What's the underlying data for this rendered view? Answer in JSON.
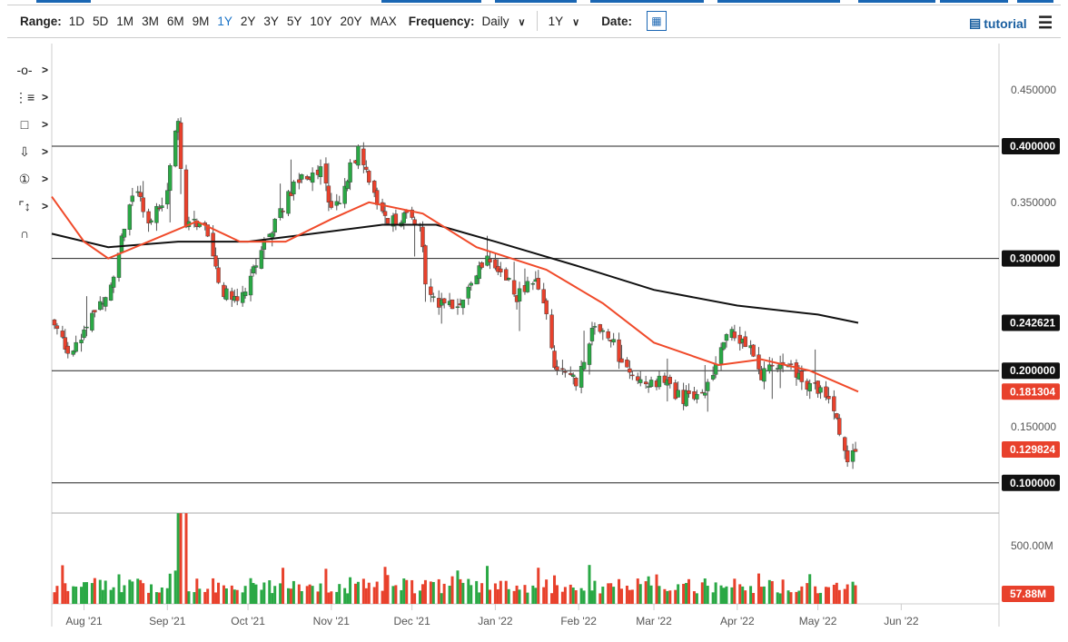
{
  "toolbar": {
    "range_label": "Range:",
    "ranges": [
      "1D",
      "5D",
      "1M",
      "3M",
      "6M",
      "9M",
      "1Y",
      "2Y",
      "3Y",
      "5Y",
      "10Y",
      "20Y",
      "MAX"
    ],
    "active_range": "1Y",
    "frequency_label": "Frequency:",
    "frequency": "Daily",
    "period": "1Y",
    "date_label": "Date:",
    "tutorial": "tutorial"
  },
  "tools": [
    "crosshair-tool",
    "trendline-tool",
    "rectangle-tool",
    "arrow-tool",
    "annotation-tool",
    "fibonacci-tool",
    "magnet-tool"
  ],
  "colors": {
    "up": "#2aa845",
    "down": "#e8412c",
    "ma_fast": "#f04a2a",
    "ma_slow": "#111111"
  },
  "chart_data": {
    "type": "candlestick",
    "x_ticks": [
      [
        "Aug '21",
        "2021-08-01"
      ],
      [
        "Sep '21",
        "2021-09-01"
      ],
      [
        "Oct '21",
        "2021-10-01"
      ],
      [
        "Nov '21",
        "2021-11-01"
      ],
      [
        "Dec '21",
        "2021-12-01"
      ],
      [
        "Jan '22",
        "2022-01-01"
      ],
      [
        "Feb '22",
        "2022-02-01"
      ],
      [
        "Mar '22",
        "2022-03-01"
      ],
      [
        "Apr '22",
        "2022-04-01"
      ],
      [
        "May '22",
        "2022-05-01"
      ],
      [
        "Jun '22",
        "2022-06-01"
      ]
    ],
    "y_ticks": [
      "0.450000",
      "0.350000",
      "0.150000"
    ],
    "y_labels_boxed": [
      {
        "v": 0.4,
        "t": "0.400000"
      },
      {
        "v": 0.3,
        "t": "0.300000"
      },
      {
        "v": 0.2,
        "t": "0.200000"
      },
      {
        "v": 0.1,
        "t": "0.100000"
      }
    ],
    "horizontal_lines": [
      0.4,
      0.3,
      0.2,
      0.1
    ],
    "ylim": [
      0.075,
      0.48
    ],
    "ma_slow_label": "0.242621",
    "ma_fast_label": "0.181304",
    "last_price_label": "0.129824",
    "volume_tick": "500.00M",
    "last_volume_label": "57.88M",
    "price_path": [
      [
        "2021-07-20",
        0.245
      ],
      [
        "2021-07-27",
        0.215
      ],
      [
        "2021-08-05",
        0.255
      ],
      [
        "2021-08-12",
        0.28
      ],
      [
        "2021-08-16",
        0.33
      ],
      [
        "2021-08-20",
        0.365
      ],
      [
        "2021-08-25",
        0.335
      ],
      [
        "2021-08-31",
        0.35
      ],
      [
        "2021-09-05",
        0.425
      ],
      [
        "2021-09-07",
        0.33
      ],
      [
        "2021-09-15",
        0.33
      ],
      [
        "2021-09-21",
        0.27
      ],
      [
        "2021-09-28",
        0.262
      ],
      [
        "2021-10-05",
        0.3
      ],
      [
        "2021-10-12",
        0.34
      ],
      [
        "2021-10-20",
        0.37
      ],
      [
        "2021-10-28",
        0.38
      ],
      [
        "2021-11-02",
        0.34
      ],
      [
        "2021-11-08",
        0.38
      ],
      [
        "2021-11-11",
        0.395
      ],
      [
        "2021-11-16",
        0.36
      ],
      [
        "2021-11-22",
        0.335
      ],
      [
        "2021-11-30",
        0.335
      ],
      [
        "2021-12-04",
        0.33
      ],
      [
        "2021-12-06",
        0.28
      ],
      [
        "2021-12-13",
        0.255
      ],
      [
        "2021-12-20",
        0.26
      ],
      [
        "2021-12-28",
        0.3
      ],
      [
        "2022-01-04",
        0.29
      ],
      [
        "2022-01-09",
        0.265
      ],
      [
        "2022-01-16",
        0.285
      ],
      [
        "2022-01-20",
        0.25
      ],
      [
        "2022-01-23",
        0.2
      ],
      [
        "2022-01-31",
        0.19
      ],
      [
        "2022-02-06",
        0.235
      ],
      [
        "2022-02-10",
        0.24
      ],
      [
        "2022-02-18",
        0.205
      ],
      [
        "2022-02-26",
        0.19
      ],
      [
        "2022-03-05",
        0.19
      ],
      [
        "2022-03-11",
        0.175
      ],
      [
        "2022-03-20",
        0.185
      ],
      [
        "2022-03-25",
        0.21
      ],
      [
        "2022-03-29",
        0.235
      ],
      [
        "2022-04-05",
        0.225
      ],
      [
        "2022-04-10",
        0.195
      ],
      [
        "2022-04-16",
        0.205
      ],
      [
        "2022-04-21",
        0.2
      ],
      [
        "2022-04-29",
        0.185
      ],
      [
        "2022-05-05",
        0.18
      ],
      [
        "2022-05-08",
        0.16
      ],
      [
        "2022-05-12",
        0.115
      ],
      [
        "2022-05-14",
        0.13
      ],
      [
        "2022-05-16",
        0.13
      ]
    ],
    "ma_slow": [
      [
        "2021-07-20",
        0.322
      ],
      [
        "2021-08-10",
        0.31
      ],
      [
        "2021-09-05",
        0.315
      ],
      [
        "2021-10-01",
        0.315
      ],
      [
        "2021-10-25",
        0.322
      ],
      [
        "2021-11-20",
        0.33
      ],
      [
        "2021-12-10",
        0.33
      ],
      [
        "2022-01-01",
        0.315
      ],
      [
        "2022-02-01",
        0.293
      ],
      [
        "2022-03-01",
        0.272
      ],
      [
        "2022-04-01",
        0.258
      ],
      [
        "2022-05-01",
        0.25
      ],
      [
        "2022-05-16",
        0.2426
      ]
    ],
    "ma_fast": [
      [
        "2021-07-20",
        0.355
      ],
      [
        "2021-08-01",
        0.315
      ],
      [
        "2021-08-10",
        0.3
      ],
      [
        "2021-08-25",
        0.315
      ],
      [
        "2021-09-12",
        0.333
      ],
      [
        "2021-09-28",
        0.315
      ],
      [
        "2021-10-15",
        0.315
      ],
      [
        "2021-11-01",
        0.335
      ],
      [
        "2021-11-15",
        0.35
      ],
      [
        "2021-12-05",
        0.34
      ],
      [
        "2021-12-25",
        0.31
      ],
      [
        "2022-01-20",
        0.29
      ],
      [
        "2022-02-10",
        0.26
      ],
      [
        "2022-03-01",
        0.225
      ],
      [
        "2022-03-25",
        0.205
      ],
      [
        "2022-04-10",
        0.21
      ],
      [
        "2022-04-28",
        0.2
      ],
      [
        "2022-05-16",
        0.1813
      ]
    ]
  }
}
